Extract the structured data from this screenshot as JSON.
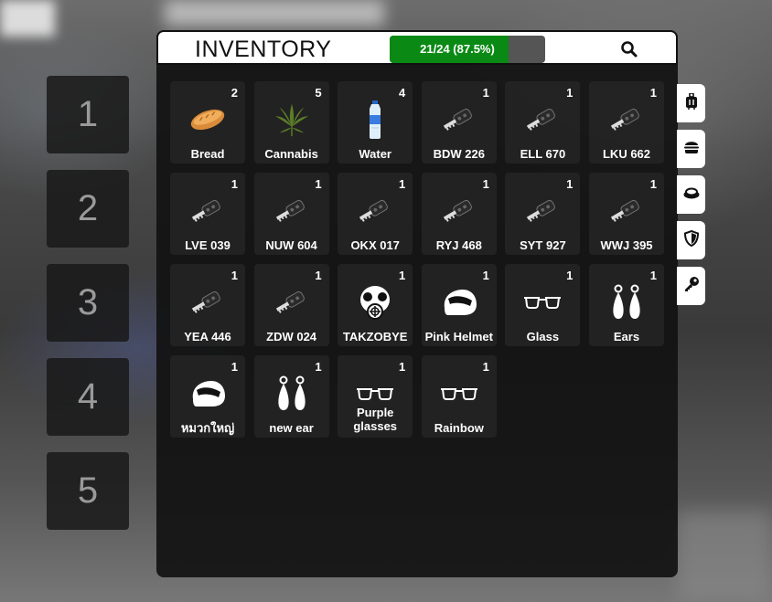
{
  "hotbar": [
    "1",
    "2",
    "3",
    "4",
    "5"
  ],
  "header": {
    "title": "INVENTORY",
    "weight_text": "21/24 (87.5%)",
    "weight_fraction": 0.875,
    "accent": "#0a8a14"
  },
  "items": [
    {
      "label": "Bread",
      "count": "2",
      "icon": "bread-icon"
    },
    {
      "label": "Cannabis",
      "count": "5",
      "icon": "cannabis-leaf-icon"
    },
    {
      "label": "Water",
      "count": "4",
      "icon": "water-bottle-icon"
    },
    {
      "label": "BDW 226",
      "count": "1",
      "icon": "car-key-icon"
    },
    {
      "label": "ELL 670",
      "count": "1",
      "icon": "car-key-icon"
    },
    {
      "label": "LKU 662",
      "count": "1",
      "icon": "car-key-icon"
    },
    {
      "label": "LVE 039",
      "count": "1",
      "icon": "car-key-icon"
    },
    {
      "label": "NUW 604",
      "count": "1",
      "icon": "car-key-icon"
    },
    {
      "label": "OKX 017",
      "count": "1",
      "icon": "car-key-icon"
    },
    {
      "label": "RYJ 468",
      "count": "1",
      "icon": "car-key-icon"
    },
    {
      "label": "SYT 927",
      "count": "1",
      "icon": "car-key-icon"
    },
    {
      "label": "WWJ 395",
      "count": "1",
      "icon": "car-key-icon"
    },
    {
      "label": "YEA 446",
      "count": "1",
      "icon": "car-key-icon"
    },
    {
      "label": "ZDW 024",
      "count": "1",
      "icon": "car-key-icon"
    },
    {
      "label": "TAKZOBYE",
      "count": "1",
      "icon": "gas-mask-icon"
    },
    {
      "label": "Pink Helmet",
      "count": "1",
      "icon": "helmet-icon"
    },
    {
      "label": "Glass",
      "count": "1",
      "icon": "glasses-icon"
    },
    {
      "label": "Ears",
      "count": "1",
      "icon": "earrings-icon"
    },
    {
      "label": "หมวกใหญ่",
      "count": "1",
      "icon": "helmet-icon"
    },
    {
      "label": "new ear",
      "count": "1",
      "icon": "earrings-icon"
    },
    {
      "label": "Purple glasses",
      "count": "1",
      "icon": "glasses-icon",
      "two_line": [
        "Purple",
        "glasses"
      ]
    },
    {
      "label": "Rainbow",
      "count": "1",
      "icon": "glasses-icon"
    }
  ],
  "tabs": [
    {
      "icon": "luggage-icon"
    },
    {
      "icon": "burger-icon"
    },
    {
      "icon": "hat-icon"
    },
    {
      "icon": "shield-icon"
    },
    {
      "icon": "key-icon"
    }
  ]
}
